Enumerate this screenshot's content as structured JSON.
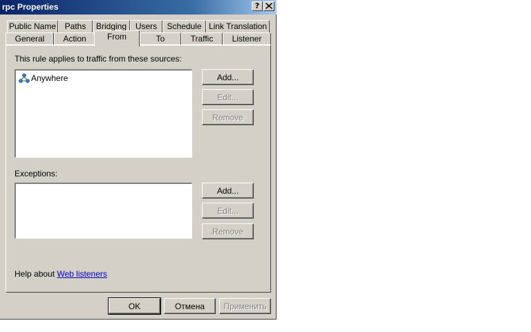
{
  "window": {
    "title": "rpc Properties",
    "help_button": "?",
    "close_button": "✕"
  },
  "tabs_row1": [
    {
      "label": "Public Name"
    },
    {
      "label": "Paths"
    },
    {
      "label": "Bridging"
    },
    {
      "label": "Users"
    },
    {
      "label": "Schedule"
    },
    {
      "label": "Link Translation"
    }
  ],
  "tabs_row2": [
    {
      "label": "General"
    },
    {
      "label": "Action"
    },
    {
      "label": "From",
      "selected": true
    },
    {
      "label": "To"
    },
    {
      "label": "Traffic"
    },
    {
      "label": "Listener"
    }
  ],
  "sources": {
    "label": "This rule applies to traffic from these sources:",
    "items": [
      {
        "label": "Anywhere",
        "icon": "network-icon"
      }
    ],
    "add_label": "Add...",
    "edit_label": "Edit...",
    "remove_label": "Remove"
  },
  "exceptions": {
    "label": "Exceptions:",
    "items": [],
    "add_label": "Add...",
    "edit_label": "Edit...",
    "remove_label": "Remove"
  },
  "help": {
    "prefix": "Help about",
    "link": "Web listeners"
  },
  "footer": {
    "ok_label": "OK",
    "cancel_label": "Отмена",
    "apply_label": "Применить"
  }
}
